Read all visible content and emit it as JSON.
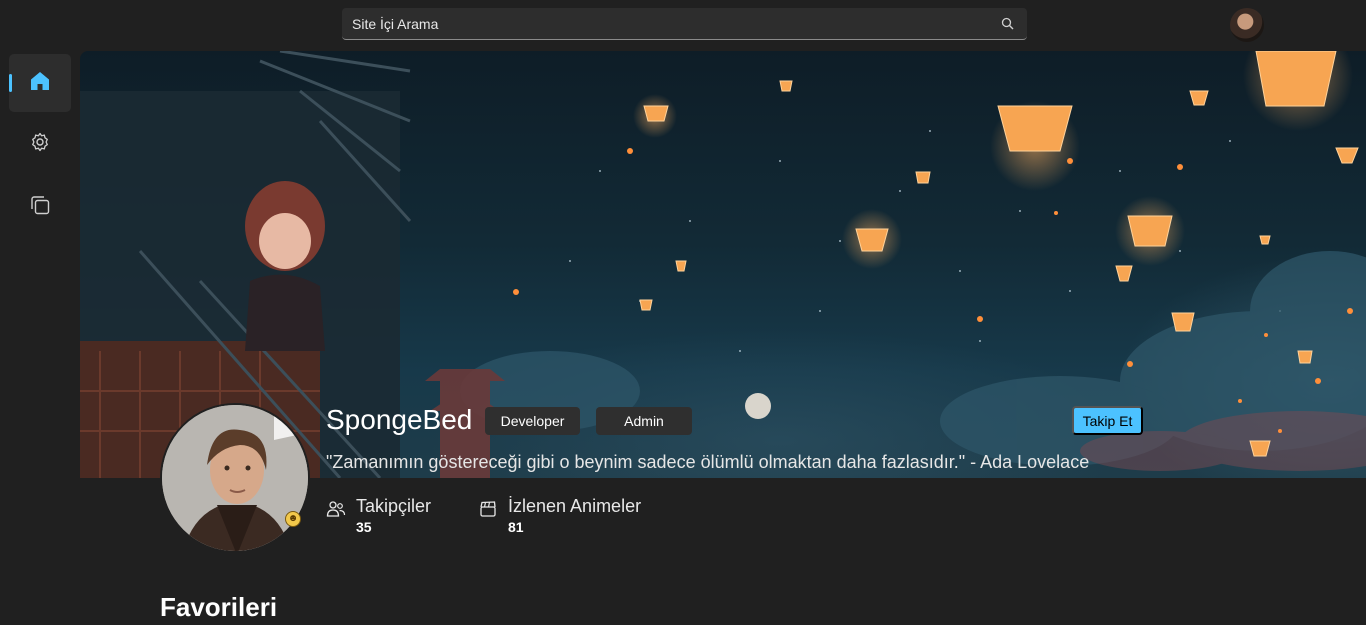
{
  "search": {
    "placeholder": "Site İçi Arama",
    "icon": "search-icon"
  },
  "sidebar": {
    "items": [
      {
        "name": "home",
        "icon": "home-icon",
        "active": true
      },
      {
        "name": "settings",
        "icon": "gear-icon",
        "active": false
      },
      {
        "name": "collection",
        "icon": "copy-icon",
        "active": false
      }
    ]
  },
  "profile": {
    "username": "SpongeBed",
    "roles": [
      "Developer",
      "Admin"
    ],
    "follow_label": "Takip Et",
    "quote": "\"Zamanımın göstereceği gibi o beynim sadece ölümlü olmaktan daha fazlasıdır.\" - Ada Lovelace",
    "stats": [
      {
        "label": "Takipçiler",
        "value": "35",
        "icon": "people-icon"
      },
      {
        "label": "İzlenen Animeler",
        "value": "81",
        "icon": "clapperboard-icon"
      }
    ]
  },
  "sections": {
    "favorites_title": "Favorileri"
  },
  "colors": {
    "accent": "#4cc2ff",
    "background": "#202020",
    "surface": "#2d2d2d"
  }
}
